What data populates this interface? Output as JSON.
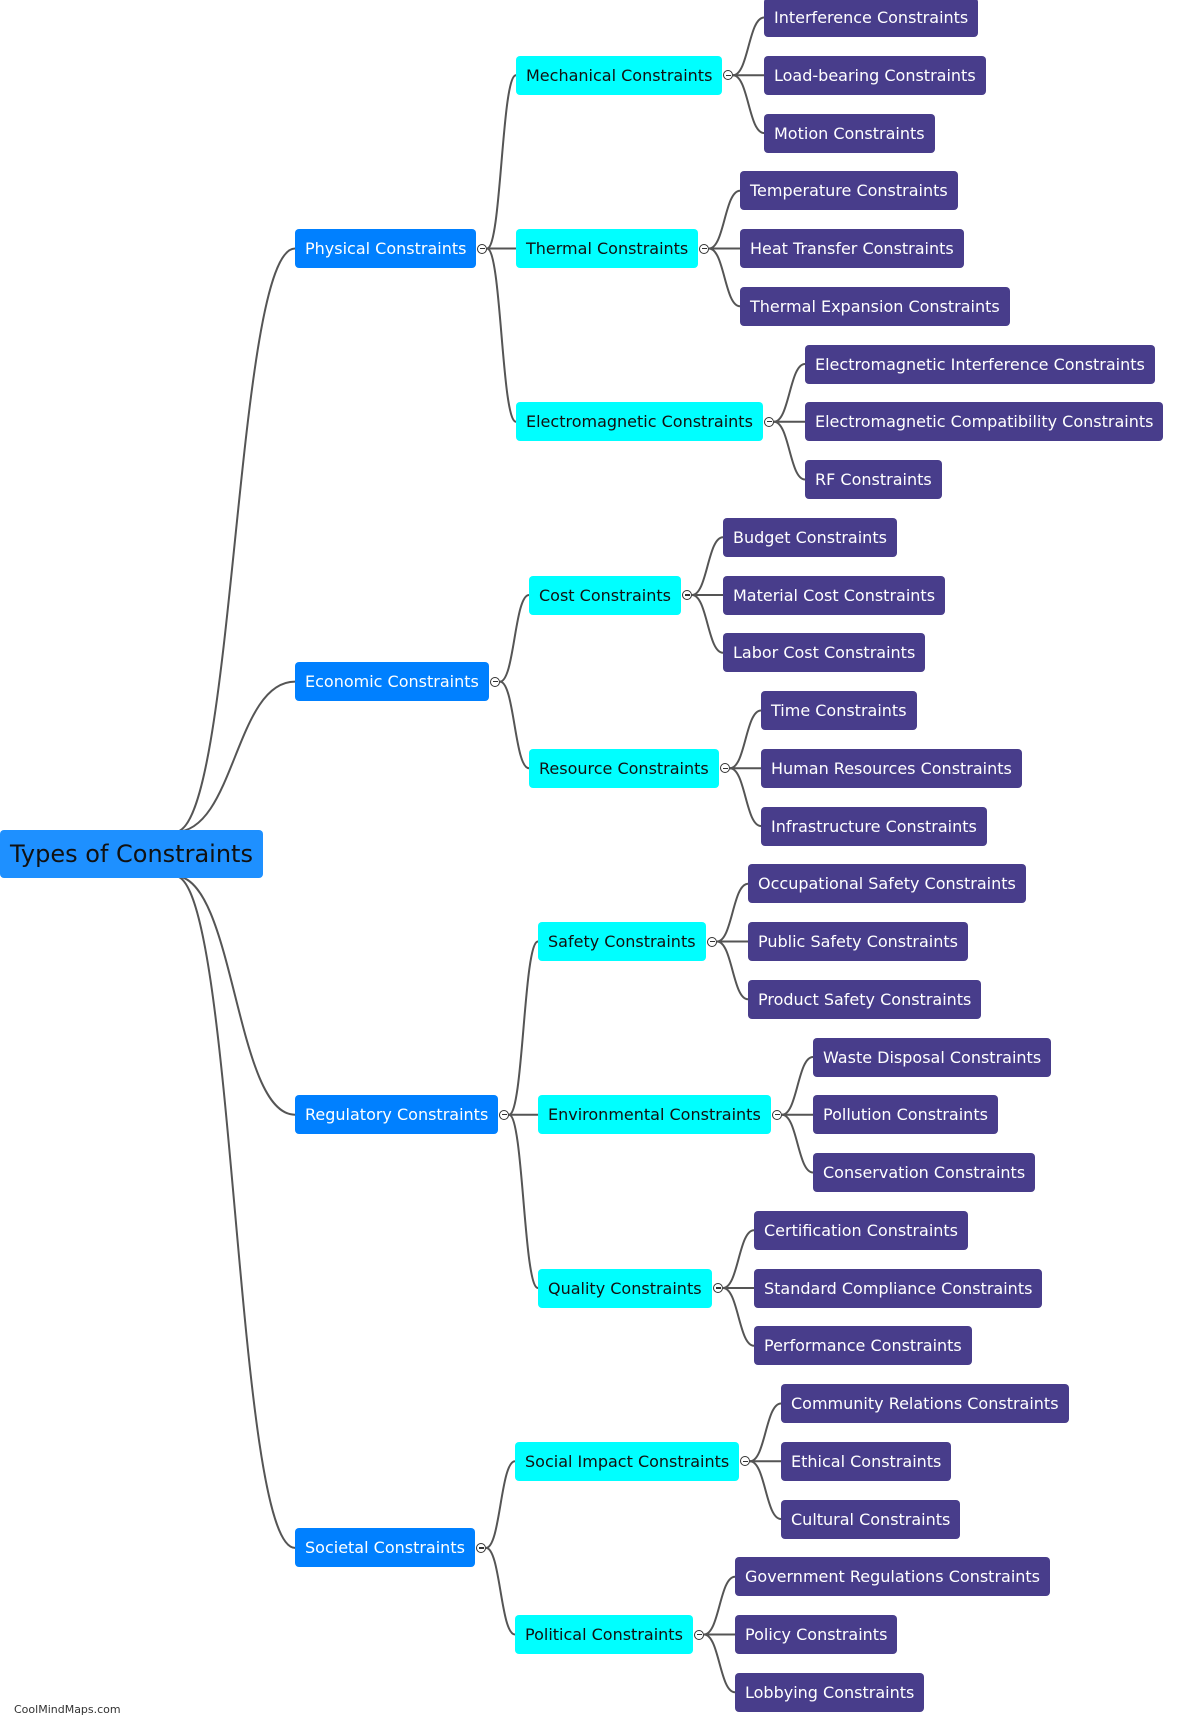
{
  "root": {
    "label": "Types of Constraints",
    "children": [
      {
        "label": "Physical Constraints",
        "children": [
          {
            "label": "Mechanical Constraints",
            "children": [
              {
                "label": "Interference Constraints"
              },
              {
                "label": "Load-bearing Constraints"
              },
              {
                "label": "Motion Constraints"
              }
            ]
          },
          {
            "label": "Thermal Constraints",
            "children": [
              {
                "label": "Temperature Constraints"
              },
              {
                "label": "Heat Transfer Constraints"
              },
              {
                "label": "Thermal Expansion Constraints"
              }
            ]
          },
          {
            "label": "Electromagnetic Constraints",
            "children": [
              {
                "label": "Electromagnetic Interference Constraints"
              },
              {
                "label": "Electromagnetic Compatibility Constraints"
              },
              {
                "label": "RF Constraints"
              }
            ]
          }
        ]
      },
      {
        "label": "Economic Constraints",
        "children": [
          {
            "label": "Cost Constraints",
            "children": [
              {
                "label": "Budget Constraints"
              },
              {
                "label": "Material Cost Constraints"
              },
              {
                "label": "Labor Cost Constraints"
              }
            ]
          },
          {
            "label": "Resource Constraints",
            "children": [
              {
                "label": "Time Constraints"
              },
              {
                "label": "Human Resources Constraints"
              },
              {
                "label": "Infrastructure Constraints"
              }
            ]
          }
        ]
      },
      {
        "label": "Regulatory Constraints",
        "children": [
          {
            "label": "Safety Constraints",
            "children": [
              {
                "label": "Occupational Safety Constraints"
              },
              {
                "label": "Public Safety Constraints"
              },
              {
                "label": "Product Safety Constraints"
              }
            ]
          },
          {
            "label": "Environmental Constraints",
            "children": [
              {
                "label": "Waste Disposal Constraints"
              },
              {
                "label": "Pollution Constraints"
              },
              {
                "label": "Conservation Constraints"
              }
            ]
          },
          {
            "label": "Quality Constraints",
            "children": [
              {
                "label": "Certification Constraints"
              },
              {
                "label": "Standard Compliance Constraints"
              },
              {
                "label": "Performance Constraints"
              }
            ]
          }
        ]
      },
      {
        "label": "Societal Constraints",
        "children": [
          {
            "label": "Social Impact Constraints",
            "children": [
              {
                "label": "Community Relations Constraints"
              },
              {
                "label": "Ethical Constraints"
              },
              {
                "label": "Cultural Constraints"
              }
            ]
          },
          {
            "label": "Political Constraints",
            "children": [
              {
                "label": "Government Regulations Constraints"
              },
              {
                "label": "Policy Constraints"
              },
              {
                "label": "Lobbying Constraints"
              }
            ]
          }
        ]
      }
    ]
  },
  "colors": {
    "root": "#1e90ff",
    "level1": "#0080ff",
    "level2": "#00ffff",
    "level3": "#483d8b",
    "link": "#555555"
  },
  "footer": {
    "watermark": "CoolMindMaps.com"
  }
}
